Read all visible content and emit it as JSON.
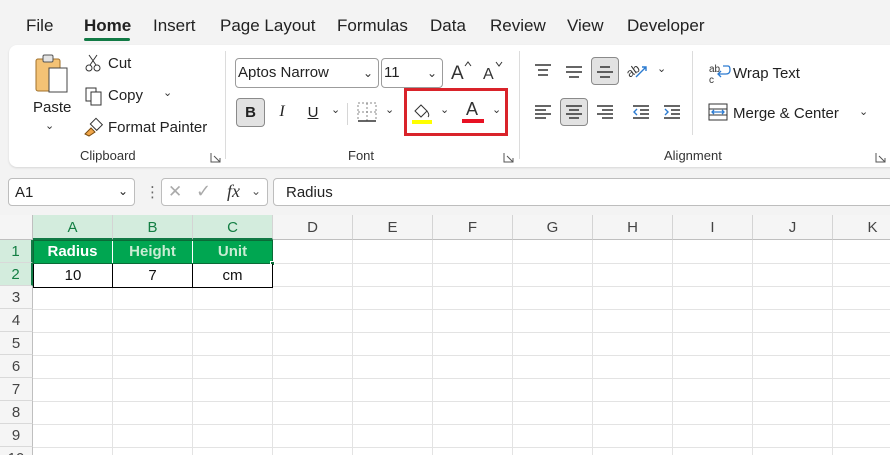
{
  "menu": {
    "tabs": [
      "File",
      "Home",
      "Insert",
      "Page Layout",
      "Formulas",
      "Data",
      "Review",
      "View",
      "Developer"
    ],
    "active": "Home"
  },
  "clipboard": {
    "paste_label": "Paste",
    "cut_label": "Cut",
    "copy_label": "Copy",
    "format_painter_label": "Format Painter",
    "group_label": "Clipboard"
  },
  "font": {
    "font_name": "Aptos Narrow",
    "font_size": "11",
    "bold_label": "B",
    "italic_label": "I",
    "underline_label": "U",
    "font_color_glyph": "A",
    "group_label": "Font",
    "fill_color": "#ffff00",
    "font_color": "#e81123"
  },
  "alignment": {
    "wrap_text_label": "Wrap Text",
    "merge_center_label": "Merge & Center",
    "group_label": "Alignment"
  },
  "formula_bar": {
    "name_box": "A1",
    "fx_label": "fx",
    "formula": "Radius"
  },
  "sheet": {
    "columns": [
      "A",
      "B",
      "C",
      "D",
      "E",
      "F",
      "G",
      "H",
      "I",
      "J",
      "K"
    ],
    "rows": [
      "1",
      "2",
      "3",
      "4",
      "5",
      "6",
      "7",
      "8",
      "9",
      "10"
    ],
    "header_row": [
      "Radius",
      "Height",
      "Unit"
    ],
    "data_row": [
      "10",
      "7",
      "cm"
    ],
    "header_fill": "#00a651"
  }
}
